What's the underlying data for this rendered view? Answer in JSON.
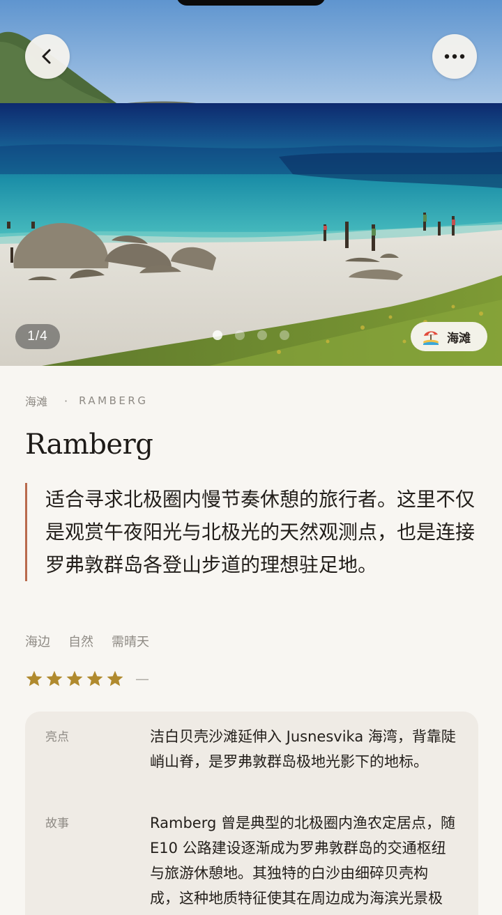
{
  "gallery": {
    "counter": "1/4",
    "total": 4,
    "active_index": 0,
    "category_chip": {
      "label": "海滩",
      "icon": "beach-umbrella-icon"
    }
  },
  "nav": {
    "back_icon": "chevron-left-icon",
    "more_icon": "more-horizontal-icon"
  },
  "place": {
    "category": "海滩",
    "region": "RAMBERG",
    "name": "Ramberg",
    "quote": "适合寻求北极圈内慢节奏休憩的旅行者。这里不仅是观赏午夜阳光与北极光的天然观测点，也是连接罗弗敦群岛各登山步道的理想驻足地。",
    "tags": [
      "海边",
      "自然",
      "需晴天"
    ],
    "rating": {
      "stars": 5,
      "note": "—"
    }
  },
  "details": [
    {
      "key": "亮点",
      "value": "洁白贝壳沙滩延伸入 Jusnesvika 海湾，背靠陡峭山脊，是罗弗敦群岛极地光影下的地标。"
    },
    {
      "key": "故事",
      "value": "Ramberg 曾是典型的北极圈内渔农定居点，随 E10 公路建设逐渐成为罗弗敦群岛的交通枢纽与旅游休憩地。其独特的白沙由细碎贝壳构成，这种地质特征使其在周边成为海滨光景极为特别。"
    }
  ],
  "colors": {
    "accent": "#b96a4d",
    "star": "#b08a2e",
    "background": "#f8f6f2",
    "card": "#efebe5"
  }
}
